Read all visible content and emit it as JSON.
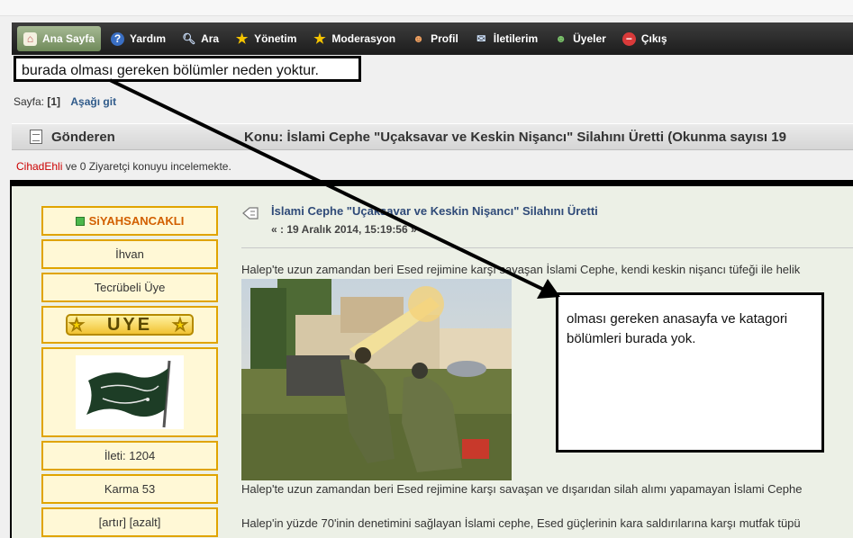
{
  "menu": {
    "items": [
      {
        "label": "Ana Sayfa",
        "icon": "home-icon",
        "active": true
      },
      {
        "label": "Yardım",
        "icon": "help-icon"
      },
      {
        "label": "Ara",
        "icon": "search-icon"
      },
      {
        "label": "Yönetim",
        "icon": "star-icon"
      },
      {
        "label": "Moderasyon",
        "icon": "star-icon"
      },
      {
        "label": "Profil",
        "icon": "user-icon"
      },
      {
        "label": "İletilerim",
        "icon": "mail-icon"
      },
      {
        "label": "Üyeler",
        "icon": "members-icon"
      },
      {
        "label": "Çıkış",
        "icon": "logout-icon"
      }
    ]
  },
  "annotations": {
    "top": "burada olması gereken bölümler neden yoktur.",
    "box": "olması gereken anasayfa ve katagori bölümleri burada yok."
  },
  "pagination": {
    "prefix": "Sayfa:",
    "current": "[1]",
    "down_link": "Aşağı git"
  },
  "topic_header": {
    "sender_label": "Gönderen",
    "topic": "Konu: İslami Cephe \"Uçaksavar ve Keskin Nişancı\" Silahını Üretti  (Okunma sayısı 19"
  },
  "viewers": {
    "user": "CihadEhli",
    "rest": " ve 0 Ziyaretçi konuyu incelemekte."
  },
  "poster": {
    "name": "SiYAHSANCAKLI",
    "group": "İhvan",
    "rank": "Tecrübeli Üye",
    "badge": "UYE",
    "posts": "İleti: 1204",
    "karma": "Karma 53",
    "karma_actions": "[artır] [azalt]"
  },
  "post": {
    "title": "İslami Cephe \"Uçaksavar ve Keskin Nişancı\" Silahını Üretti",
    "date": "« : 19 Aralık 2014, 15:19:56 »",
    "p1": "Halep'te uzun zamandan beri Esed rejimine karşı savaşan İslami Cephe, kendi keskin nişancı tüfeği ile helik",
    "p2": "Halep'te uzun zamandan beri Esed rejimine karşı savaşan ve dışarıdan silah alımı yapamayan İslami Cephe",
    "p3": "Halep'in yüzde 70'inin denetimini sağlayan İslami cephe, Esed güçlerinin kara saldırılarına karşı mutfak tüpü"
  },
  "colors": {
    "menu_bg": "#1c1c1c",
    "active_tab": "#7f9a68",
    "username_red": "#cc0000",
    "poster_border": "#e0a400"
  }
}
